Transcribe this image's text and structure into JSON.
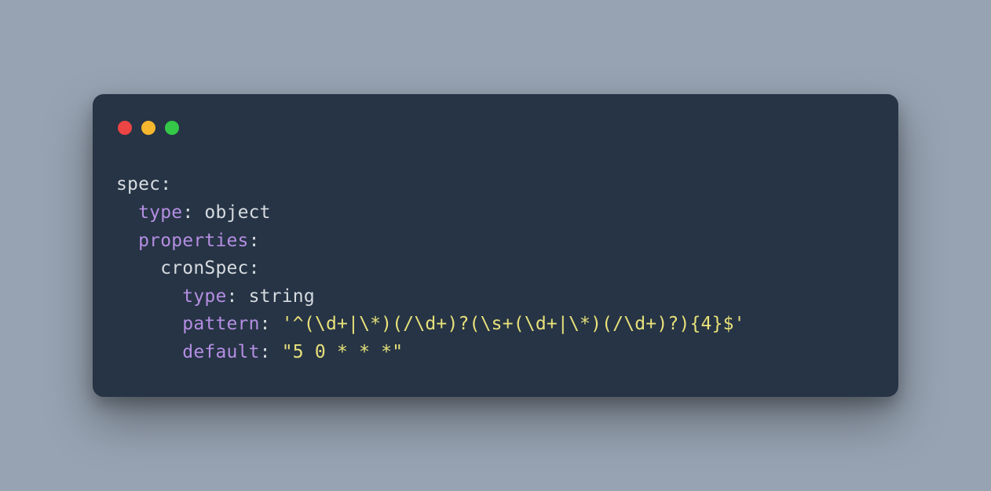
{
  "colors": {
    "bg": "#97a3b2",
    "window": "#263445",
    "red": "#ed4444",
    "yellow": "#f5b72e",
    "green": "#34c748",
    "keyLight": "#d7dbe0",
    "keyPurple": "#b48ee2",
    "string": "#e8e17a"
  },
  "code": {
    "l1": {
      "key": "spec",
      "colon": ":"
    },
    "l2": {
      "indent": "  ",
      "key": "type",
      "colon": ": ",
      "val": "object"
    },
    "l3": {
      "indent": "  ",
      "key": "properties",
      "colon": ":"
    },
    "l4": {
      "indent": "    ",
      "key": "cronSpec",
      "colon": ":"
    },
    "l5": {
      "indent": "      ",
      "key": "type",
      "colon": ": ",
      "val": "string"
    },
    "l6": {
      "indent": "      ",
      "key": "pattern",
      "colon": ": ",
      "val": "'^(\\d+|\\*)(/\\d+)?(\\s+(\\d+|\\*)(/\\d+)?){4}$'"
    },
    "l7": {
      "indent": "      ",
      "key": "default",
      "colon": ": ",
      "val": "\"5 0 * * *\""
    }
  }
}
